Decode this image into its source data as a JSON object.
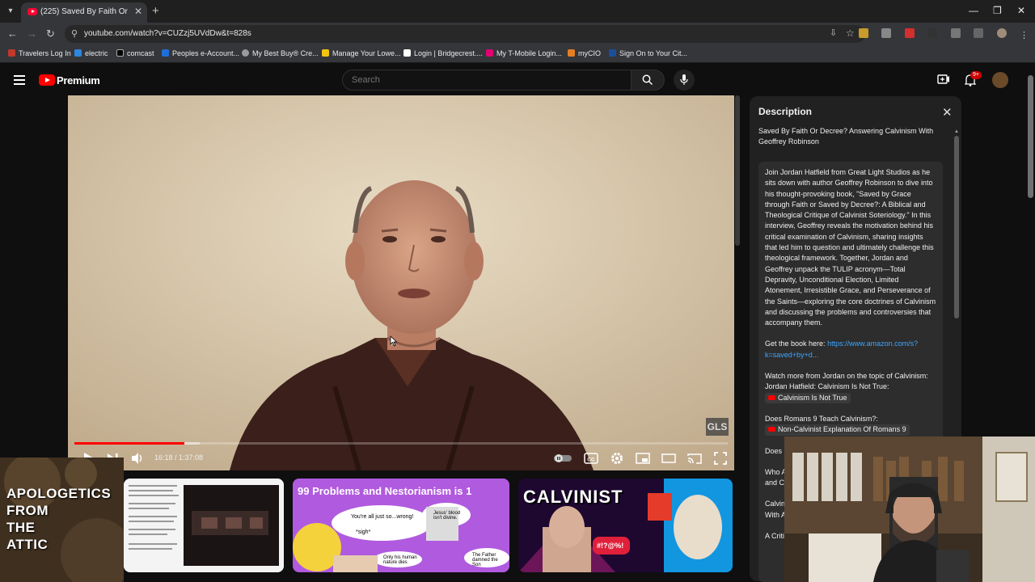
{
  "browser": {
    "tab_title": "(225) Saved By Faith Or Decree?",
    "tab_close": "✕",
    "new_tab": "+",
    "url": "youtube.com/watch?v=CUZzj5UVdDw&t=828s",
    "window_controls": {
      "minimize": "—",
      "restore": "❐",
      "close": "✕"
    },
    "bookmarks": [
      {
        "label": "Travelers Log In",
        "color": "#c0392b"
      },
      {
        "label": "electric",
        "color": "#2e86de"
      },
      {
        "label": "comcast",
        "color": "#ffffff"
      },
      {
        "label": "Peoples e-Account...",
        "color": "#1e6fd9"
      },
      {
        "label": "My Best Buy® Cre...",
        "color": "#9b9b9b"
      },
      {
        "label": "Manage Your Lowe...",
        "color": "#f1c40f"
      },
      {
        "label": "Login | Bridgecrest....",
        "color": "#ffffff"
      },
      {
        "label": "My T-Mobile Login...",
        "color": "#e20074"
      },
      {
        "label": "myCIO",
        "color": "#e67e22"
      },
      {
        "label": "Sign On to Your Cit...",
        "color": "#1a4f9c"
      }
    ]
  },
  "youtube": {
    "brand": "Premium",
    "search_placeholder": "Search",
    "notification_count": "9+"
  },
  "player": {
    "current_time": "16:18",
    "duration": "1:37:08",
    "time_display": "16:18 / 1:37:08",
    "progress_fraction": 0.168,
    "buffer_fraction": 0.192,
    "watermark": "GLS"
  },
  "description": {
    "heading": "Description",
    "close": "✕",
    "video_title": "Saved By Faith Or Decree? Answering Calvinism With Geoffrey Robinson",
    "body_paragraph": "Join Jordan Hatfield from Great Light Studios as he sits down with author Geoffrey Robinson to dive into his thought-provoking book, \"Saved by Grace through Faith or Saved by Decree?: A Biblical and Theological Critique of Calvinist Soteriology.\" In this interview, Geoffrey reveals the motivation behind his critical examination of Calvinism, sharing insights that led him to question and ultimately challenge this theological framework. Together, Jordan and Geoffrey unpack the TULIP acronym—Total Depravity, Unconditional Election, Limited Atonement, Irresistible Grace, and Perseverance of the Saints—exploring the core doctrines of Calvinism and discussing the problems and controversies that accompany them.",
    "book_label": "Get the book here:",
    "book_link": "https://www.amazon.com/s?k=saved+by+d...",
    "watch_more": "Watch more from Jordan on the topic of Calvinism:",
    "watch_more_2": "Jordan Hatfield: Calvinism Is Not True:",
    "chip1": "Calvinism Is Not True",
    "romans_q": "Does Romans 9 Teach Calvinism?:",
    "chip2": "Non-Calvinist Explanation Of Romans 9",
    "tail_lines": [
      "Does",
      "Who A",
      "and C",
      "Calvin",
      "With A",
      "A Criti"
    ]
  },
  "overlay": {
    "brand_text": [
      "APOLOGETICS",
      "FROM",
      "THE",
      "ATTIC"
    ]
  },
  "thumbnails": [
    {
      "title": ""
    },
    {
      "title": "99 Problems and Nestorianism is 1",
      "bubbles": [
        "You're all just so...wrong!",
        "*sigh*",
        "Jesus' blood isn't divine.",
        "Only his human nature dies",
        "The Father damned the Son"
      ]
    },
    {
      "title": "CALVINIST",
      "sub": "#!?@%!"
    }
  ]
}
